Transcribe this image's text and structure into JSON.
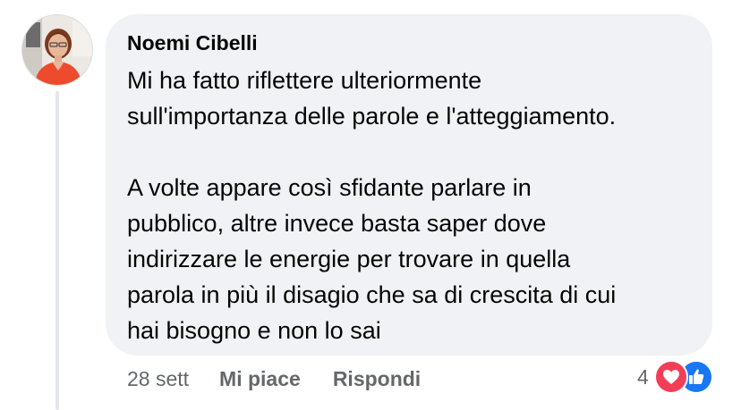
{
  "comment": {
    "author": "Noemi Cibelli",
    "text": "Mi ha fatto riflettere ulteriormente\nsull'importanza delle parole e l'atteggiamento.\n\nA volte appare così sfidante parlare in\npubblico, altre invece basta saper dove\nindirizzare le energie per trovare in quella\nparola in più il disagio che sa di crescita di cui\nhai bisogno e non lo sai",
    "timestamp": "28 sett",
    "like_label": "Mi piace",
    "reply_label": "Rispondi",
    "reaction_count": "4",
    "reaction_icons": [
      "heart-icon",
      "thumbs-up-icon"
    ]
  },
  "colors": {
    "bubble": "#f0f2f5",
    "meta_text": "#65676b",
    "heart": "#f33e58",
    "like": "#1877f2"
  }
}
